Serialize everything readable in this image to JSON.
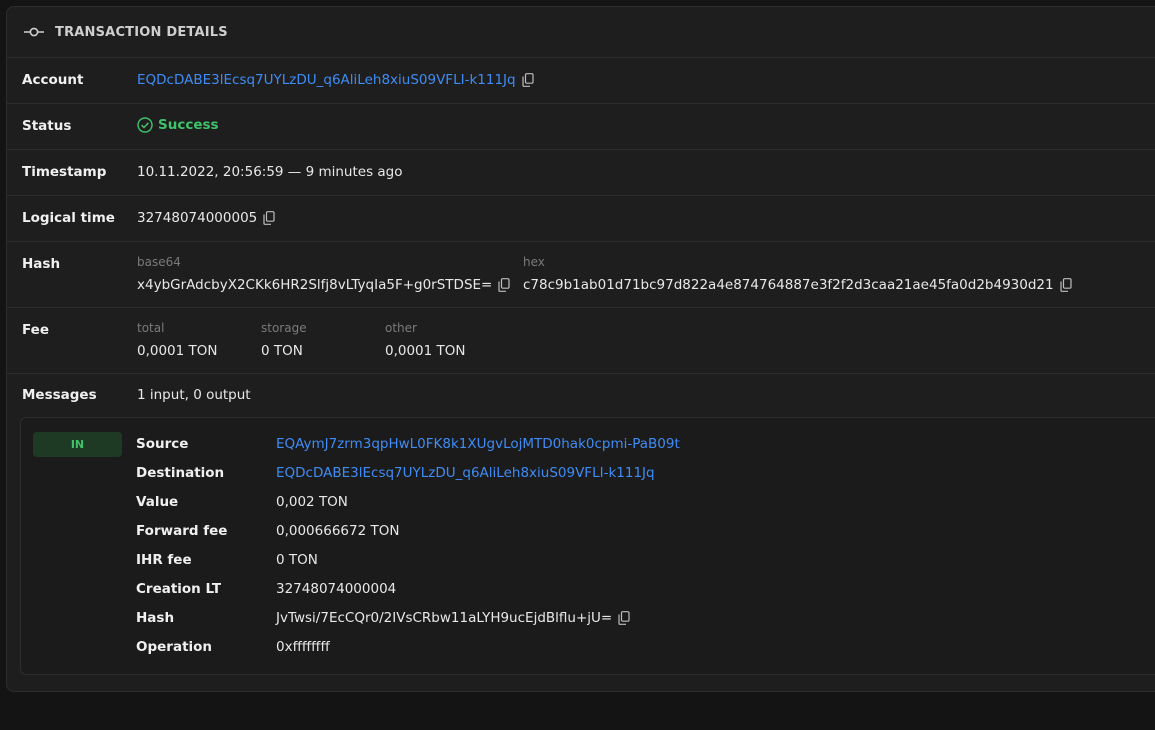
{
  "header": {
    "title": "TRANSACTION DETAILS",
    "icon": "commit-icon"
  },
  "account": {
    "label": "Account",
    "value": "EQDcDABE3lEcsq7UYLzDU_q6AliLeh8xiuS09VFLI-k111Jq"
  },
  "status": {
    "label": "Status",
    "value": "Success",
    "color": "#3ec36b"
  },
  "timestamp": {
    "label": "Timestamp",
    "value": "10.11.2022, 20:56:59 — 9 minutes ago"
  },
  "logical_time": {
    "label": "Logical time",
    "value": "32748074000005"
  },
  "hash": {
    "label": "Hash",
    "base64_label": "base64",
    "base64_value": "x4ybGrAdcbyX2CKk6HR2Slfj8vLTyqIa5F+g0rSTDSE=",
    "hex_label": "hex",
    "hex_value": "c78c9b1ab01d71bc97d822a4e874764887e3f2f2d3caa21ae45fa0d2b4930d21"
  },
  "fee": {
    "label": "Fee",
    "total_label": "total",
    "total_value": "0,0001 TON",
    "storage_label": "storage",
    "storage_value": "0 TON",
    "other_label": "other",
    "other_value": "0,0001 TON"
  },
  "messages": {
    "label": "Messages",
    "summary": "1 input, 0 output",
    "items": [
      {
        "badge": "IN",
        "source_label": "Source",
        "source": "EQAymJ7zrm3qpHwL0FK8k1XUgvLojMTD0hak0cpmi-PaB09t",
        "destination_label": "Destination",
        "destination": "EQDcDABE3lEcsq7UYLzDU_q6AliLeh8xiuS09VFLI-k111Jq",
        "value_label": "Value",
        "value": "0,002 TON",
        "forward_fee_label": "Forward fee",
        "forward_fee": "0,000666672 TON",
        "ihr_fee_label": "IHR fee",
        "ihr_fee": "0 TON",
        "creation_lt_label": "Creation LT",
        "creation_lt": "32748074000004",
        "hash_label": "Hash",
        "hash": "JvTwsi/7EcCQr0/2IVsCRbw11aLYH9ucEjdBlflu+jU=",
        "operation_label": "Operation",
        "operation": "0xffffffff"
      }
    ]
  },
  "colors": {
    "link": "#3f8cf5",
    "success": "#3ec36b",
    "background": "#141414",
    "panel": "#1e1e1e"
  }
}
